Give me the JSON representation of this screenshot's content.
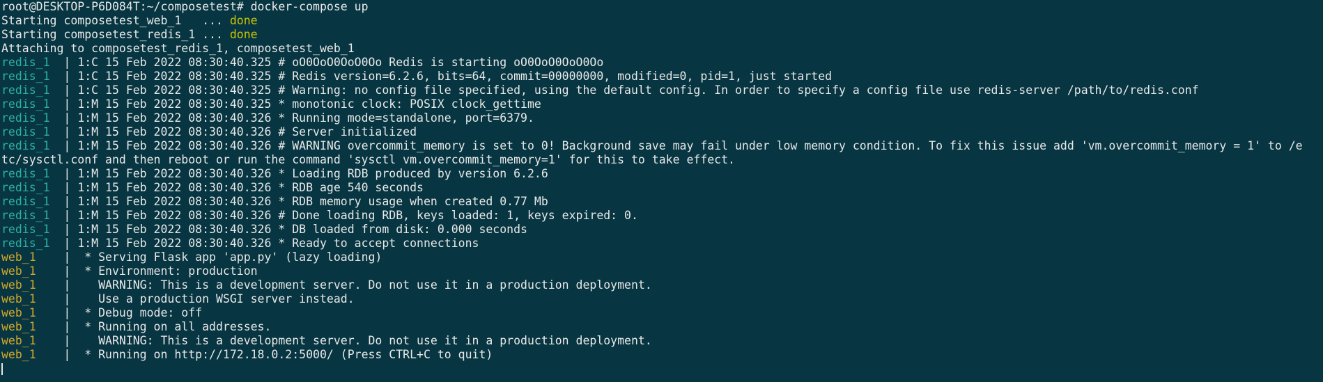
{
  "terminal": {
    "prompt": "root@DESKTOP-P6D084T:~/composetest# ",
    "command": "docker-compose up",
    "starting": [
      {
        "text": "Starting composetest_web_1   ... ",
        "status": "done"
      },
      {
        "text": "Starting composetest_redis_1 ... ",
        "status": "done"
      }
    ],
    "attaching": "Attaching to composetest_redis_1, composetest_web_1",
    "logs": [
      {
        "service": "redis_1  ",
        "sep": "| ",
        "msg": "1:C 15 Feb 2022 08:30:40.325 # oO0OoO0OoO0Oo Redis is starting oO0OoO0OoO0Oo"
      },
      {
        "service": "redis_1  ",
        "sep": "| ",
        "msg": "1:C 15 Feb 2022 08:30:40.325 # Redis version=6.2.6, bits=64, commit=00000000, modified=0, pid=1, just started"
      },
      {
        "service": "redis_1  ",
        "sep": "| ",
        "msg": "1:C 15 Feb 2022 08:30:40.325 # Warning: no config file specified, using the default config. In order to specify a config file use redis-server /path/to/redis.conf"
      },
      {
        "service": "redis_1  ",
        "sep": "| ",
        "msg": "1:M 15 Feb 2022 08:30:40.325 * monotonic clock: POSIX clock_gettime"
      },
      {
        "service": "redis_1  ",
        "sep": "| ",
        "msg": "1:M 15 Feb 2022 08:30:40.326 * Running mode=standalone, port=6379."
      },
      {
        "service": "redis_1  ",
        "sep": "| ",
        "msg": "1:M 15 Feb 2022 08:30:40.326 # Server initialized"
      },
      {
        "service": "redis_1  ",
        "sep": "| ",
        "msg": "1:M 15 Feb 2022 08:30:40.326 # WARNING overcommit_memory is set to 0! Background save may fail under low memory condition. To fix this issue add 'vm.overcommit_memory = 1' to /e"
      },
      {
        "service": "",
        "sep": "",
        "msg": "tc/sysctl.conf and then reboot or run the command 'sysctl vm.overcommit_memory=1' for this to take effect."
      },
      {
        "service": "redis_1  ",
        "sep": "| ",
        "msg": "1:M 15 Feb 2022 08:30:40.326 * Loading RDB produced by version 6.2.6"
      },
      {
        "service": "redis_1  ",
        "sep": "| ",
        "msg": "1:M 15 Feb 2022 08:30:40.326 * RDB age 540 seconds"
      },
      {
        "service": "redis_1  ",
        "sep": "| ",
        "msg": "1:M 15 Feb 2022 08:30:40.326 * RDB memory usage when created 0.77 Mb"
      },
      {
        "service": "redis_1  ",
        "sep": "| ",
        "msg": "1:M 15 Feb 2022 08:30:40.326 # Done loading RDB, keys loaded: 1, keys expired: 0."
      },
      {
        "service": "redis_1  ",
        "sep": "| ",
        "msg": "1:M 15 Feb 2022 08:30:40.326 * DB loaded from disk: 0.000 seconds"
      },
      {
        "service": "redis_1  ",
        "sep": "| ",
        "msg": "1:M 15 Feb 2022 08:30:40.326 * Ready to accept connections"
      },
      {
        "service": "web_1    ",
        "sep": "| ",
        "msg": " * Serving Flask app 'app.py' (lazy loading)"
      },
      {
        "service": "web_1    ",
        "sep": "| ",
        "msg": " * Environment: production"
      },
      {
        "service": "web_1    ",
        "sep": "| ",
        "msg": "   WARNING: This is a development server. Do not use it in a production deployment."
      },
      {
        "service": "web_1    ",
        "sep": "| ",
        "msg": "   Use a production WSGI server instead."
      },
      {
        "service": "web_1    ",
        "sep": "| ",
        "msg": " * Debug mode: off"
      },
      {
        "service": "web_1    ",
        "sep": "| ",
        "msg": " * Running on all addresses."
      },
      {
        "service": "web_1    ",
        "sep": "| ",
        "msg": "   WARNING: This is a development server. Do not use it in a production deployment."
      },
      {
        "service": "web_1    ",
        "sep": "| ",
        "msg": " * Running on http://172.18.0.2:5000/ (Press CTRL+C to quit)"
      }
    ]
  },
  "colors": {
    "background": "#073642",
    "text": "#e8e8e8",
    "done": "#c9c400",
    "redis": "#2fb0a4",
    "web": "#d4a92a"
  }
}
